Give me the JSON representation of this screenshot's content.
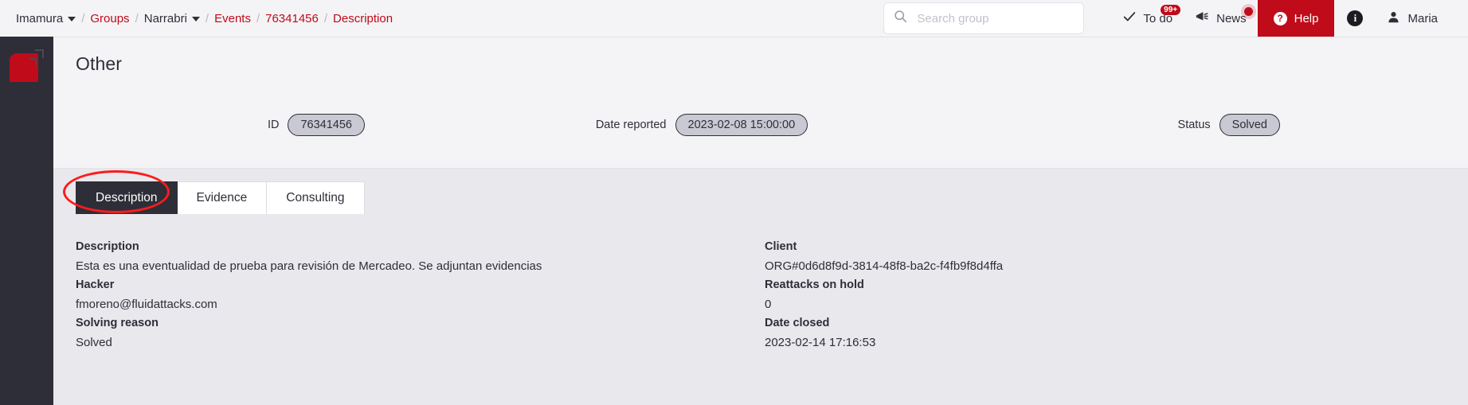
{
  "topbar": {
    "breadcrumb": [
      {
        "label": "Imamura",
        "type": "dropdown",
        "style": "plain"
      },
      {
        "label": "Groups",
        "type": "link",
        "style": "link"
      },
      {
        "label": "Narrabri",
        "type": "dropdown",
        "style": "plain"
      },
      {
        "label": "Events",
        "type": "link",
        "style": "link"
      },
      {
        "label": "76341456",
        "type": "link",
        "style": "link"
      },
      {
        "label": "Description",
        "type": "link",
        "style": "link"
      }
    ],
    "separator": "/",
    "search": {
      "placeholder": "Search group",
      "value": "",
      "icon": "search-icon"
    },
    "todo": {
      "label": "To do",
      "badge": "99+",
      "icon": "check-icon"
    },
    "news": {
      "label": "News",
      "icon": "megaphone-icon",
      "has_dot": true
    },
    "help": {
      "label": "Help",
      "icon": "question-circle-icon"
    },
    "info": {
      "icon": "info-circle-icon"
    },
    "user": {
      "label": "Maria",
      "icon": "user-icon"
    }
  },
  "sidebar": {
    "logo": "fluid-attacks-logo"
  },
  "header": {
    "title": "Other",
    "meta": [
      {
        "label": "ID",
        "value": "76341456"
      },
      {
        "label": "Date reported",
        "value": "2023-02-08 15:00:00"
      },
      {
        "label": "Status",
        "value": "Solved"
      }
    ]
  },
  "tabs": [
    {
      "label": "Description",
      "active": true
    },
    {
      "label": "Evidence",
      "active": false
    },
    {
      "label": "Consulting",
      "active": false
    }
  ],
  "details": {
    "left": [
      {
        "label": "Description",
        "value": "Esta es una eventualidad de prueba para revisión de Mercadeo. Se adjuntan evidencias"
      },
      {
        "label": "Hacker",
        "value": "fmoreno@fluidattacks.com"
      },
      {
        "label": "Solving reason",
        "value": "Solved"
      }
    ],
    "right": [
      {
        "label": "Client",
        "value": "ORG#0d6d8f9d-3814-48f8-ba2c-f4fb9f8d4ffa"
      },
      {
        "label": "Reattacks on hold",
        "value": "0"
      },
      {
        "label": "Date closed",
        "value": "2023-02-14 17:16:53"
      }
    ]
  },
  "colors": {
    "brand_red": "#bf0b1a",
    "annotation_red": "#fb1c1c",
    "dark": "#2e2e38",
    "chip_bg": "#c9c9d4",
    "page_bg": "#e8e8ed"
  }
}
